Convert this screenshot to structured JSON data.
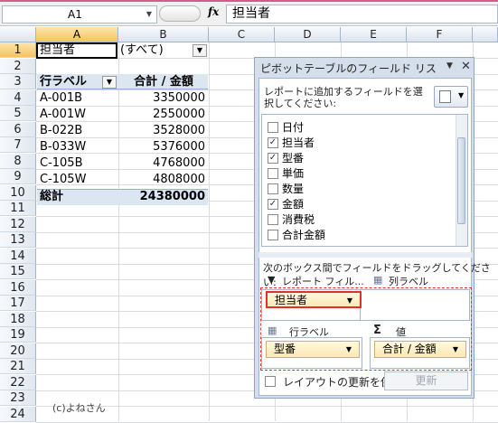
{
  "formula_bar": {
    "name_box": "A1",
    "fx_label": "fx",
    "formula": "担当者"
  },
  "columns": [
    "A",
    "B",
    "C",
    "D",
    "E",
    "F"
  ],
  "rows": [
    "1",
    "2",
    "3",
    "4",
    "5",
    "6",
    "7",
    "8",
    "9",
    "10",
    "11",
    "12",
    "13",
    "14",
    "15",
    "16",
    "17",
    "18",
    "19",
    "20",
    "21",
    "22",
    "23",
    "24"
  ],
  "sheet": {
    "filter_label": "担当者",
    "filter_value": "(すべて)",
    "header_label": "行ラベル",
    "header_value": "合計 / 金額",
    "data_rows": [
      {
        "label": "A-001B",
        "value": "3350000"
      },
      {
        "label": "A-001W",
        "value": "2550000"
      },
      {
        "label": "B-022B",
        "value": "3528000"
      },
      {
        "label": "B-033W",
        "value": "5376000"
      },
      {
        "label": "C-105B",
        "value": "4768000"
      },
      {
        "label": "C-105W",
        "value": "4808000"
      }
    ],
    "total_label": "総計",
    "total_value": "24380000",
    "copyright": "(c)よねさん"
  },
  "pivot": {
    "title": "ピボットテーブルのフィールド リス",
    "instruction": "レポートに追加するフィールドを選択してください:",
    "fields": [
      {
        "label": "日付",
        "checked": false
      },
      {
        "label": "担当者",
        "checked": true
      },
      {
        "label": "型番",
        "checked": true
      },
      {
        "label": "単価",
        "checked": false
      },
      {
        "label": "数量",
        "checked": false
      },
      {
        "label": "金額",
        "checked": true
      },
      {
        "label": "消費税",
        "checked": false
      },
      {
        "label": "合計金額",
        "checked": false
      }
    ],
    "drag_text": "次のボックス間でフィールドをドラッグしてください:",
    "report_filter_label": "レポート フィル...",
    "column_label_label": "列ラベル",
    "row_label_label": "行ラベル",
    "values_label": "値",
    "filter_pill": "担当者",
    "row_pill": "型番",
    "value_pill": "合計 / 金額",
    "defer_label": "レイアウトの更新を保...",
    "update_button": "更新"
  }
}
